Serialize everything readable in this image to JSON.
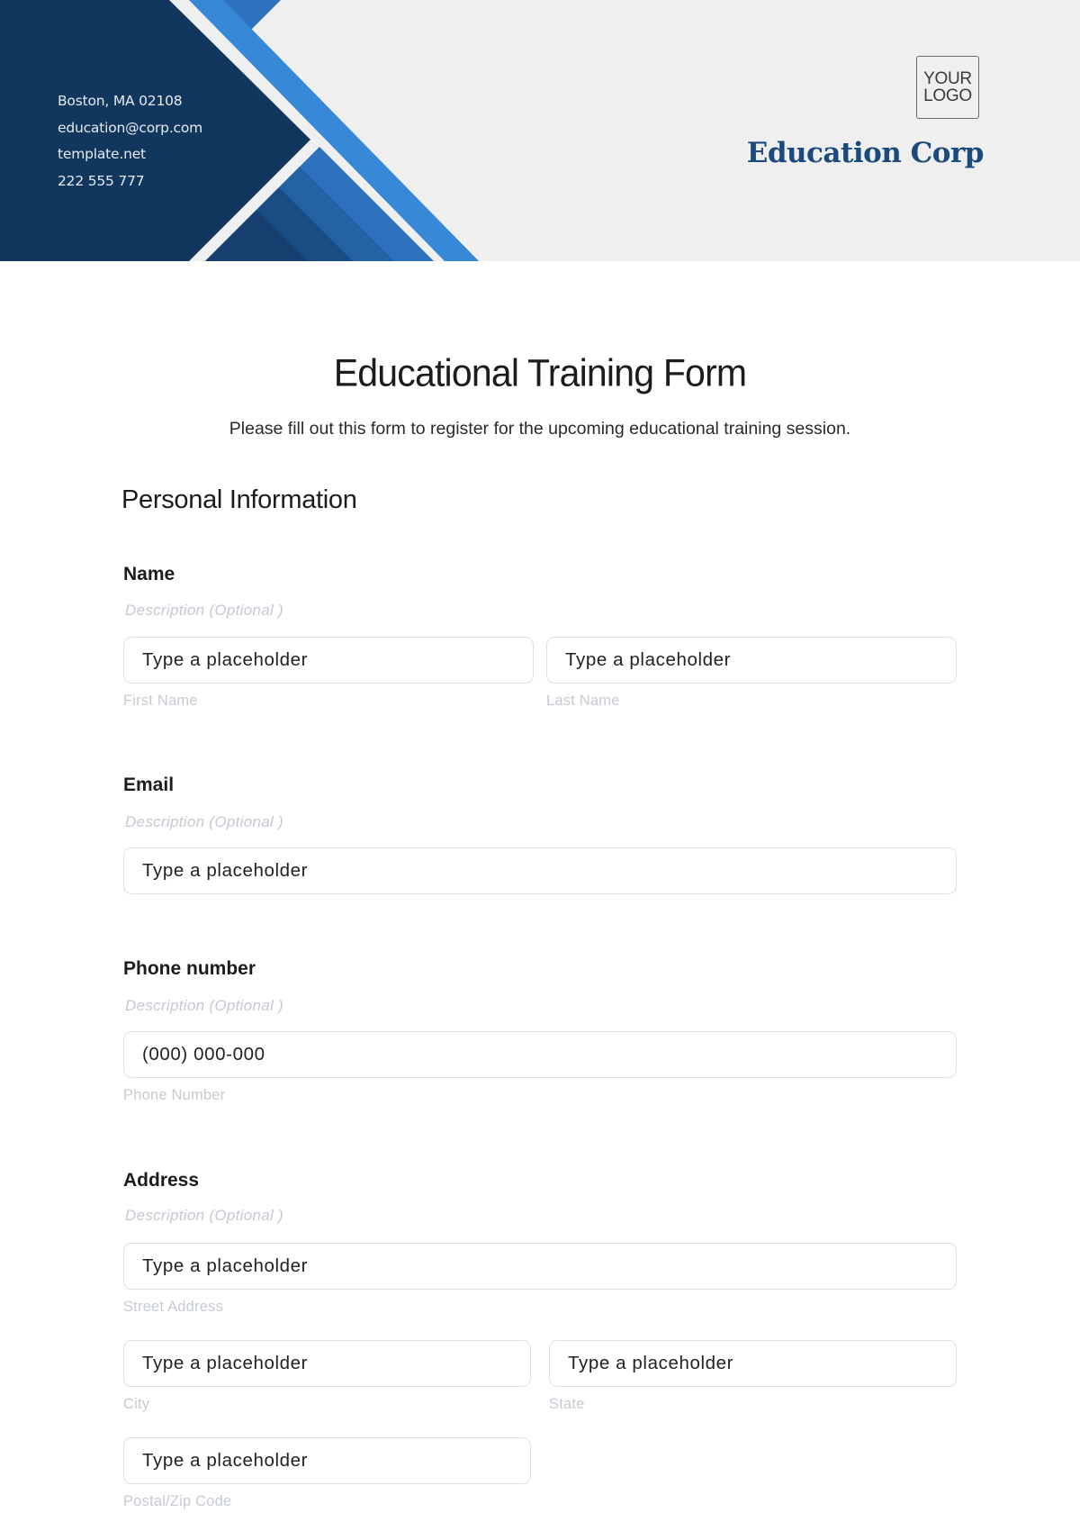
{
  "header": {
    "contact_lines": [
      "Boston, MA 02108",
      "education@corp.com",
      "template.net",
      "222 555 777"
    ],
    "logo_line1": "YOUR",
    "logo_line2": "LOGO",
    "company_name": "Education Corp",
    "colors": {
      "navy": "#12375f",
      "mid_blue": "#2e72bf",
      "bright_blue": "#3789d8",
      "band_dark": "#1b4d85",
      "band_mid": "#2362a3",
      "background": "#efefef",
      "company_text": "#1b4a7d"
    }
  },
  "form": {
    "title": "Educational Training Form",
    "subtitle": "Please fill out this form to register for the upcoming educational training session.",
    "section_title": "Personal Information",
    "questions": {
      "name": {
        "label": "Name",
        "description": "Description  (Optional )",
        "fields": [
          {
            "placeholder": "Type a placeholder",
            "sublabel": "First Name"
          },
          {
            "placeholder": "Type a placeholder",
            "sublabel": "Last Name"
          }
        ]
      },
      "email": {
        "label": "Email",
        "description": "Description  (Optional )",
        "fields": [
          {
            "placeholder": "Type a placeholder"
          }
        ]
      },
      "phone": {
        "label": "Phone number",
        "description": "Description  (Optional )",
        "fields": [
          {
            "placeholder": "(000) 000-000",
            "sublabel": "Phone Number"
          }
        ]
      },
      "address": {
        "label": "Address",
        "description": "Description  (Optional )",
        "fields": [
          {
            "placeholder": "Type a placeholder",
            "sublabel": "Street Address"
          },
          {
            "placeholder": "Type a placeholder",
            "sublabel": "City"
          },
          {
            "placeholder": "Type a placeholder",
            "sublabel": "State"
          },
          {
            "placeholder": "Type a placeholder",
            "sublabel": "Postal/Zip Code"
          }
        ]
      }
    }
  }
}
